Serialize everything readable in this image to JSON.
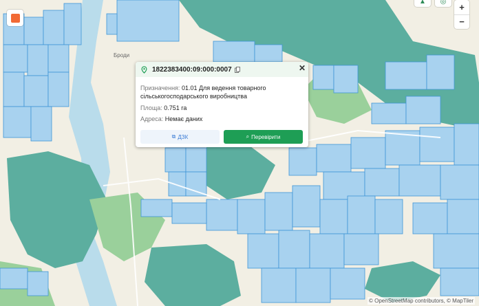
{
  "map": {
    "town_label": "Броди",
    "attribution": "© OpenStreetMap contributors, © MapTiler",
    "colors": {
      "land": "#f2efe4",
      "forest": "#9ad09b",
      "parcel_fill": "#a8d2ef",
      "parcel_line": "#3f95d6",
      "forest_parcel": "#5cae9f",
      "water": "#b9dceb"
    }
  },
  "controls": {
    "layer_icon": "layers-icon",
    "top_left_icon": "navigation-icon",
    "top_right_icon": "globe-icon",
    "zoom_in": "+",
    "zoom_out": "−"
  },
  "popup": {
    "cadastral_number": "1822383400:09:000:0007",
    "pin_icon": "location-pin-icon",
    "copy_icon": "copy-icon",
    "close": "✕",
    "purpose_label": "Призначення:",
    "purpose_value_line1": "01.01 Для ведення товарного",
    "purpose_value_line2": "сільськогосподарського виробництва",
    "area_label": "Площа:",
    "area_value": "0.751 га",
    "address_label": "Адреса:",
    "address_value": "Немає даних",
    "dzk_button": "ДЗК",
    "dzk_icon": "external-link-icon",
    "check_button": "Перевірити",
    "check_icon": "search-icon"
  }
}
